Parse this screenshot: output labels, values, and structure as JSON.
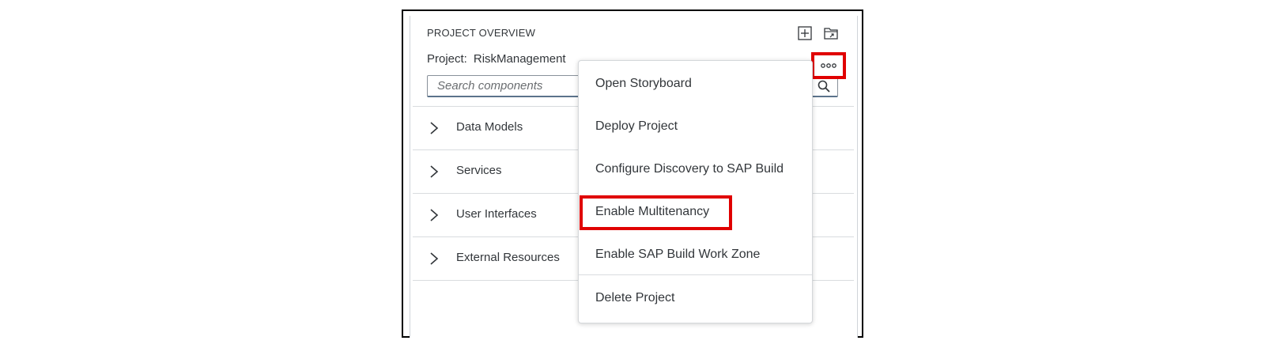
{
  "panel": {
    "title": "PROJECT OVERVIEW",
    "project_label": "Project:",
    "project_name": "RiskManagement",
    "search_placeholder": "Search components"
  },
  "header_icons": [
    "add-icon",
    "open-folder-icon"
  ],
  "tree_items": [
    {
      "label": "Data Models",
      "icon": "chevron-right-icon"
    },
    {
      "label": "Services",
      "icon": "chevron-right-icon"
    },
    {
      "label": "User Interfaces",
      "icon": "chevron-right-icon"
    },
    {
      "label": "External Resources",
      "icon": "chevron-right-icon"
    }
  ],
  "more_button_icon": "ellipsis-icon",
  "menu": {
    "items": [
      {
        "label": "Open Storyboard"
      },
      {
        "label": "Deploy Project"
      },
      {
        "label": "Configure Discovery to SAP Build"
      },
      {
        "label": "Enable Multitenancy"
      },
      {
        "label": "Enable SAP Build Work Zone"
      },
      {
        "label": "Delete Project"
      }
    ]
  },
  "colors": {
    "highlight": "#e00000",
    "text": "#32363a",
    "border": "#d9dcdf",
    "search_border": "#5b738b"
  }
}
